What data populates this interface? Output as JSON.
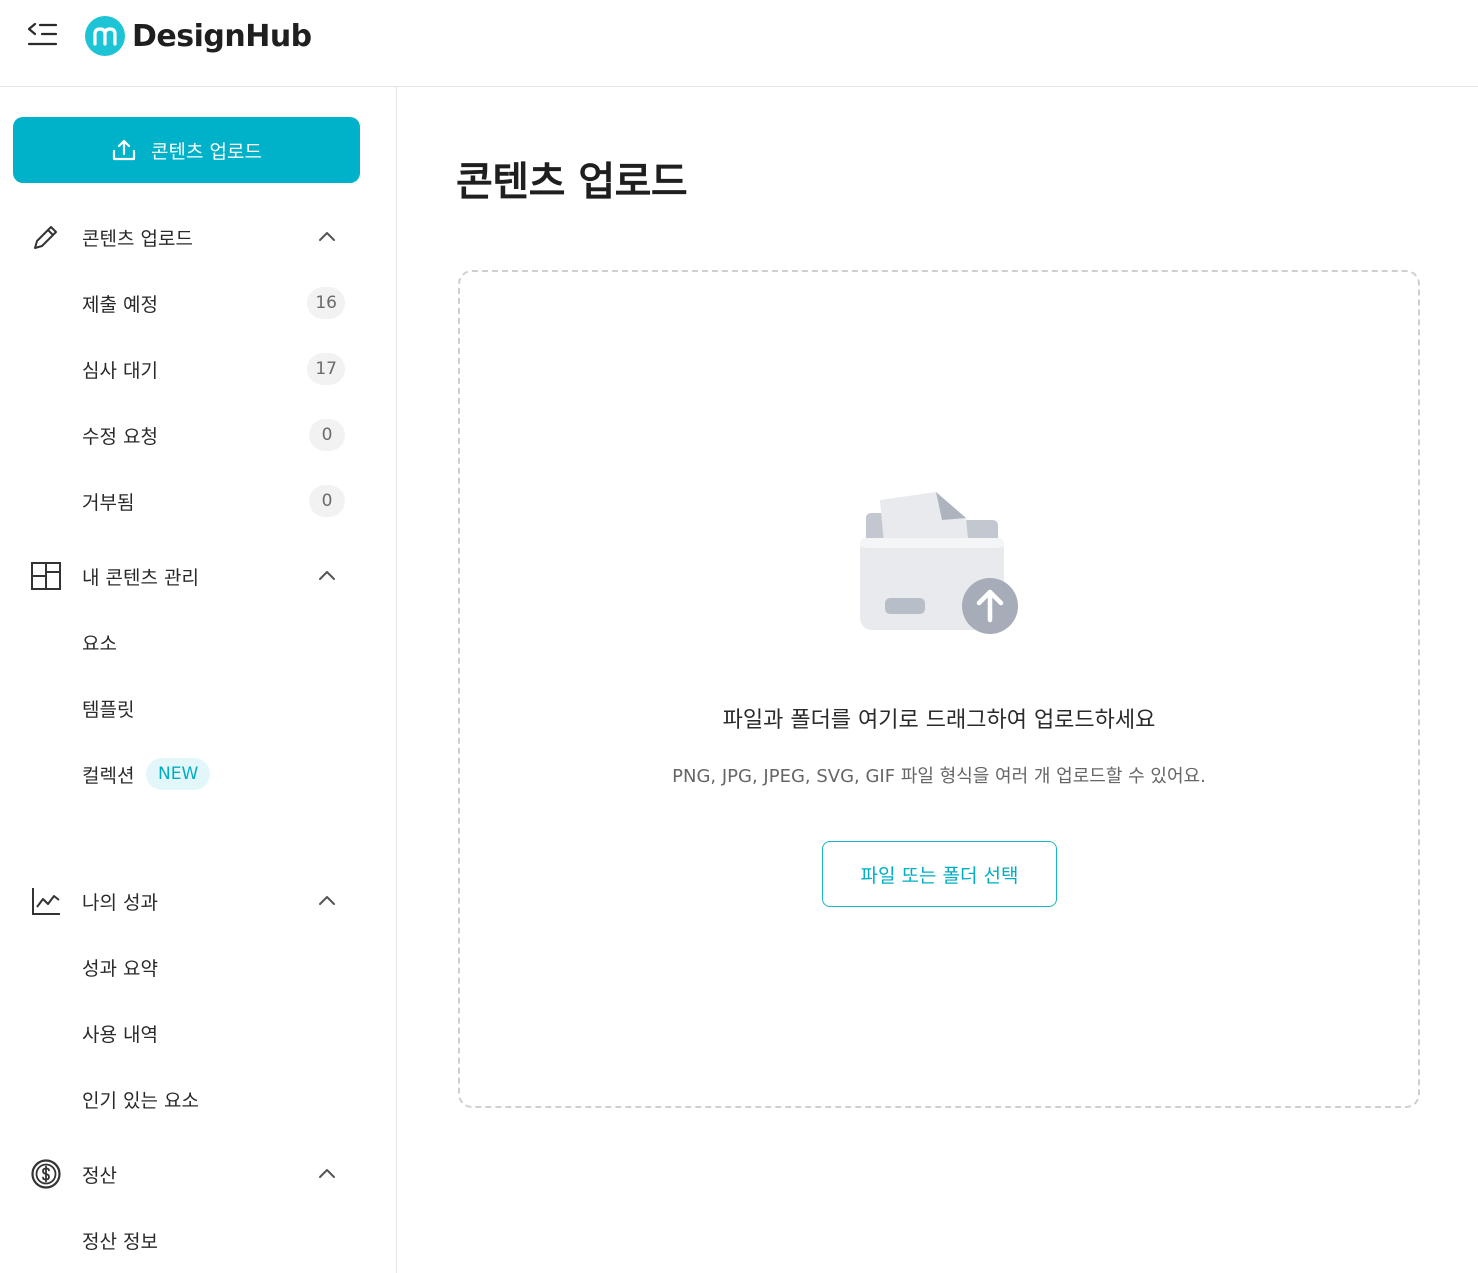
{
  "header": {
    "logo_text": "DesignHub"
  },
  "sidebar": {
    "upload_button_label": "콘텐츠 업로드",
    "sections": [
      {
        "label": "콘텐츠 업로드",
        "icon": "pencil-icon",
        "items": [
          {
            "label": "제출 예정",
            "count": "16"
          },
          {
            "label": "심사 대기",
            "count": "17"
          },
          {
            "label": "수정 요청",
            "count": "0"
          },
          {
            "label": "거부됨",
            "count": "0"
          }
        ]
      },
      {
        "label": "내 콘텐츠 관리",
        "icon": "layout-grid-icon",
        "items": [
          {
            "label": "요소"
          },
          {
            "label": "템플릿"
          },
          {
            "label": "컬렉션",
            "badge": "NEW"
          }
        ]
      },
      {
        "label": "나의 성과",
        "icon": "line-chart-icon",
        "items": [
          {
            "label": "성과 요약"
          },
          {
            "label": "사용 내역"
          },
          {
            "label": "인기 있는 요소"
          }
        ]
      },
      {
        "label": "정산",
        "icon": "dollar-circle-icon",
        "items": [
          {
            "label": "정산 정보"
          }
        ]
      }
    ]
  },
  "main": {
    "title": "콘텐츠 업로드",
    "dropzone": {
      "heading": "파일과 폴더를 여기로 드래그하여 업로드하세요",
      "subtext": "PNG, JPG, JPEG, SVG, GIF 파일 형식을 여러 개 업로드할 수 있어요.",
      "button_label": "파일 또는 폴더 선택"
    }
  },
  "colors": {
    "accent": "#00b2c9",
    "logo": "#1cc4d6",
    "badge_bg": "#e3f7fa",
    "count_bg": "#f2f2f2",
    "border": "#e6e6e6"
  }
}
